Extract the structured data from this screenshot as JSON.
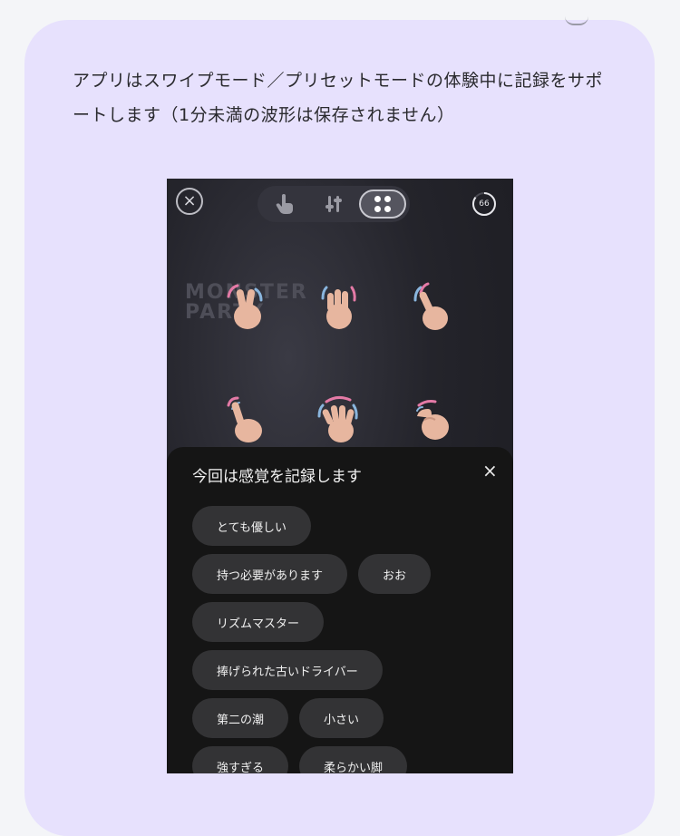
{
  "description": "アプリはスワイプモード／プリセットモードの体験中に記録をサポートします（1分未満の波形は保存されません）",
  "phone": {
    "close_glyph": "×",
    "modes": [
      "hand-pointer-icon",
      "sliders-icon",
      "grid-dots-icon"
    ],
    "active_mode": "grid-dots-icon",
    "timer_value": "66",
    "timer_progress": 0.85,
    "background_title": "MONSTER\nPARTY",
    "hands": [
      "peace-hand-icon",
      "open-hand-icon",
      "two-finger-hand-icon",
      "pointing-hand-icon",
      "wave-hand-icon",
      "fist-hand-icon"
    ]
  },
  "sheet": {
    "title": "今回は感覚を記録します",
    "close_glyph": "×",
    "chips": [
      [
        "とても優しい"
      ],
      [
        "持つ必要があります",
        "おお"
      ],
      [
        "リズムマスター"
      ],
      [
        "捧げられた古いドライバー"
      ],
      [
        "第二の潮",
        "小さい"
      ],
      [
        "強すぎる",
        "柔らかい脚"
      ]
    ]
  },
  "colors": {
    "card_bg": "#e7e1fd",
    "page_bg": "#f4f5f8",
    "sheet_bg": "#151515",
    "chip_bg": "#333335",
    "accent_pink": "#e47aa6",
    "accent_blue": "#8ab6de",
    "skin": "#e7b69f"
  }
}
